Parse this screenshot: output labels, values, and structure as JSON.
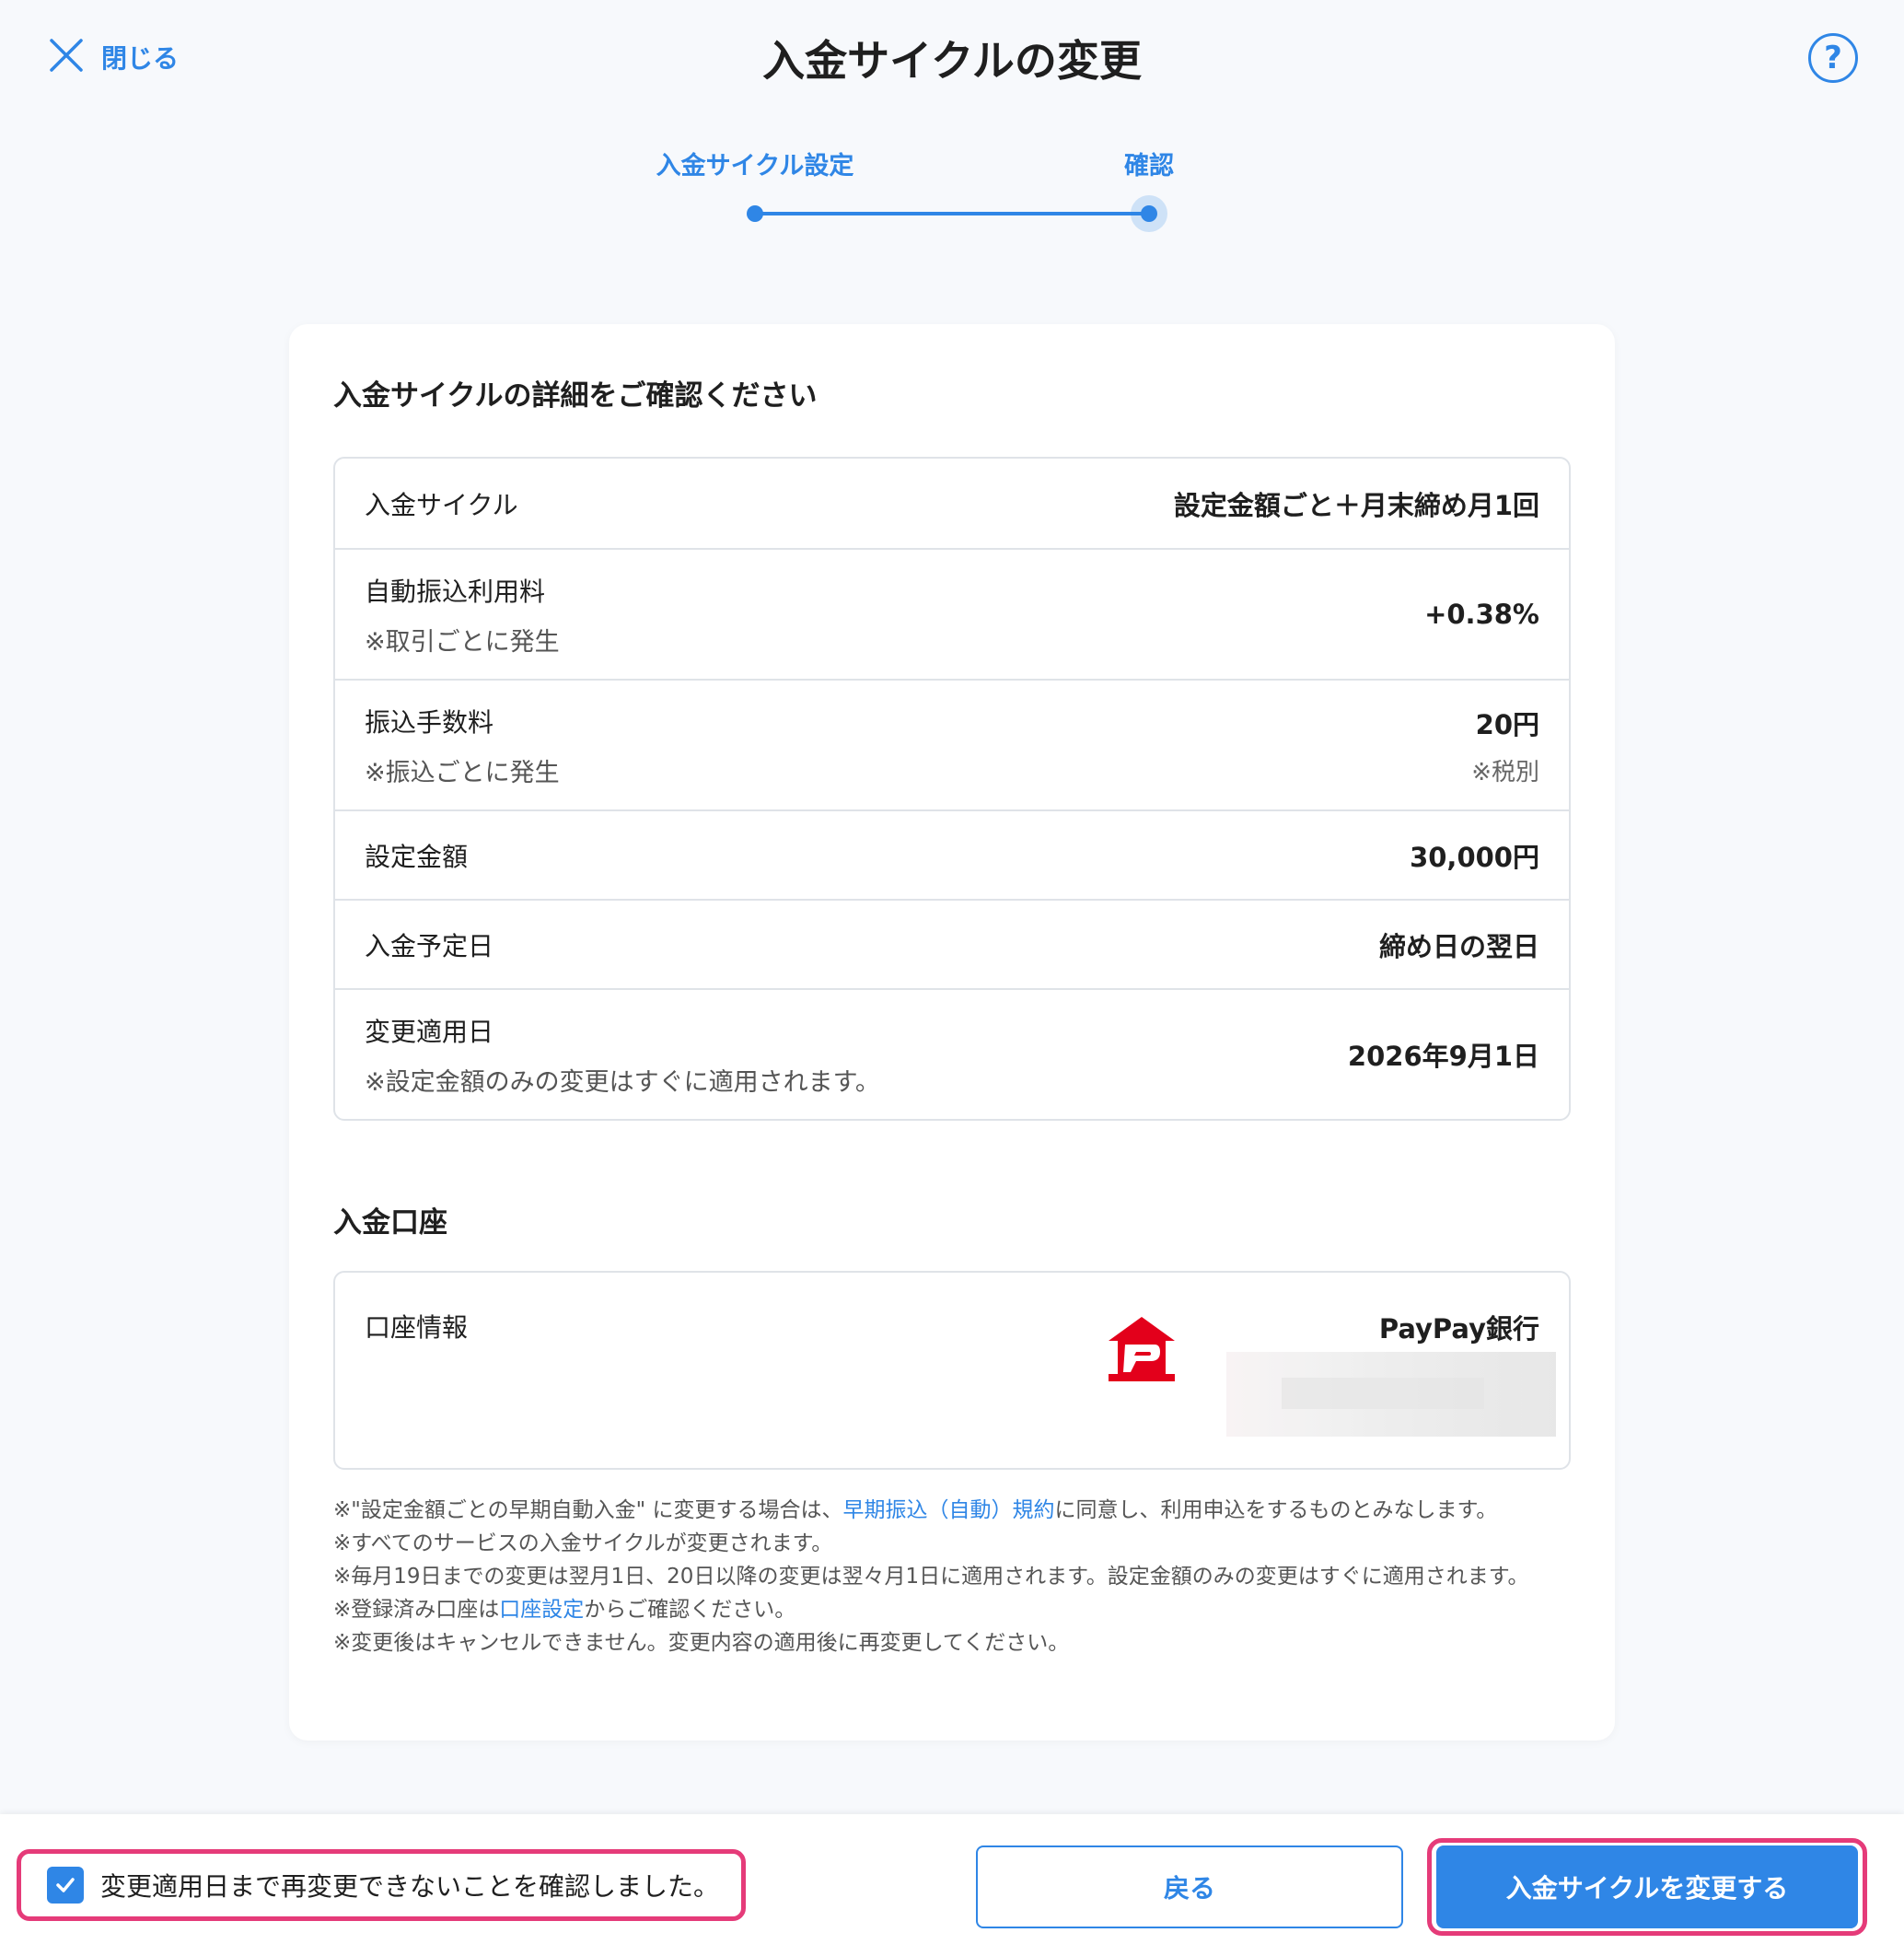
{
  "header": {
    "close_label": "閉じる",
    "title": "入金サイクルの変更",
    "help_label": "?"
  },
  "stepper": {
    "steps": [
      {
        "label": "入金サイクル設定"
      },
      {
        "label": "確認"
      }
    ]
  },
  "details": {
    "title": "入金サイクルの詳細をご確認ください",
    "rows": [
      {
        "label": "入金サイクル",
        "sub": "",
        "value": "設定金額ごと＋月末締め月1回",
        "value_sub": ""
      },
      {
        "label": "自動振込利用料",
        "sub": "※取引ごとに発生",
        "value": "+0.38%",
        "value_sub": ""
      },
      {
        "label": "振込手数料",
        "sub": "※振込ごとに発生",
        "value": "20円",
        "value_sub": "※税別"
      },
      {
        "label": "設定金額",
        "sub": "",
        "value": "30,000円",
        "value_sub": ""
      },
      {
        "label": "入金予定日",
        "sub": "",
        "value": "締め日の翌日",
        "value_sub": ""
      },
      {
        "label": "変更適用日",
        "sub": "※設定金額のみの変更はすぐに適用されます。",
        "value": "2026年9月1日",
        "value_sub": ""
      }
    ]
  },
  "account": {
    "title": "入金口座",
    "label": "口座情報",
    "bank_name": "PayPay銀行"
  },
  "notes": {
    "n1_prefix": "※\"設定金額ごとの早期自動入金\" に変更する場合は、",
    "n1_link": "早期振込（自動）規約",
    "n1_suffix": "に同意し、利用申込をするものとみなします。",
    "n2": "※すべてのサービスの入金サイクルが変更されます。",
    "n3": "※毎月19日までの変更は翌月1日、20日以降の変更は翌々月1日に適用されます。設定金額のみの変更はすぐに適用されます。",
    "n4_prefix": "※登録済み口座は",
    "n4_link": "口座設定",
    "n4_suffix": "からご確認ください。",
    "n5": "※変更後はキャンセルできません。変更内容の適用後に再変更してください。"
  },
  "footer": {
    "confirm_label": "変更適用日まで再変更できないことを確認しました。",
    "confirm_checked": true,
    "back_label": "戻る",
    "submit_label": "入金サイクルを変更する"
  },
  "colors": {
    "accent": "#2f86e6",
    "highlight": "#e53b79",
    "logo_red": "#e3001b"
  },
  "icons": {
    "close": "close-icon",
    "help": "help-icon",
    "check": "check-icon",
    "bank_logo": "paypay-bank-logo"
  }
}
